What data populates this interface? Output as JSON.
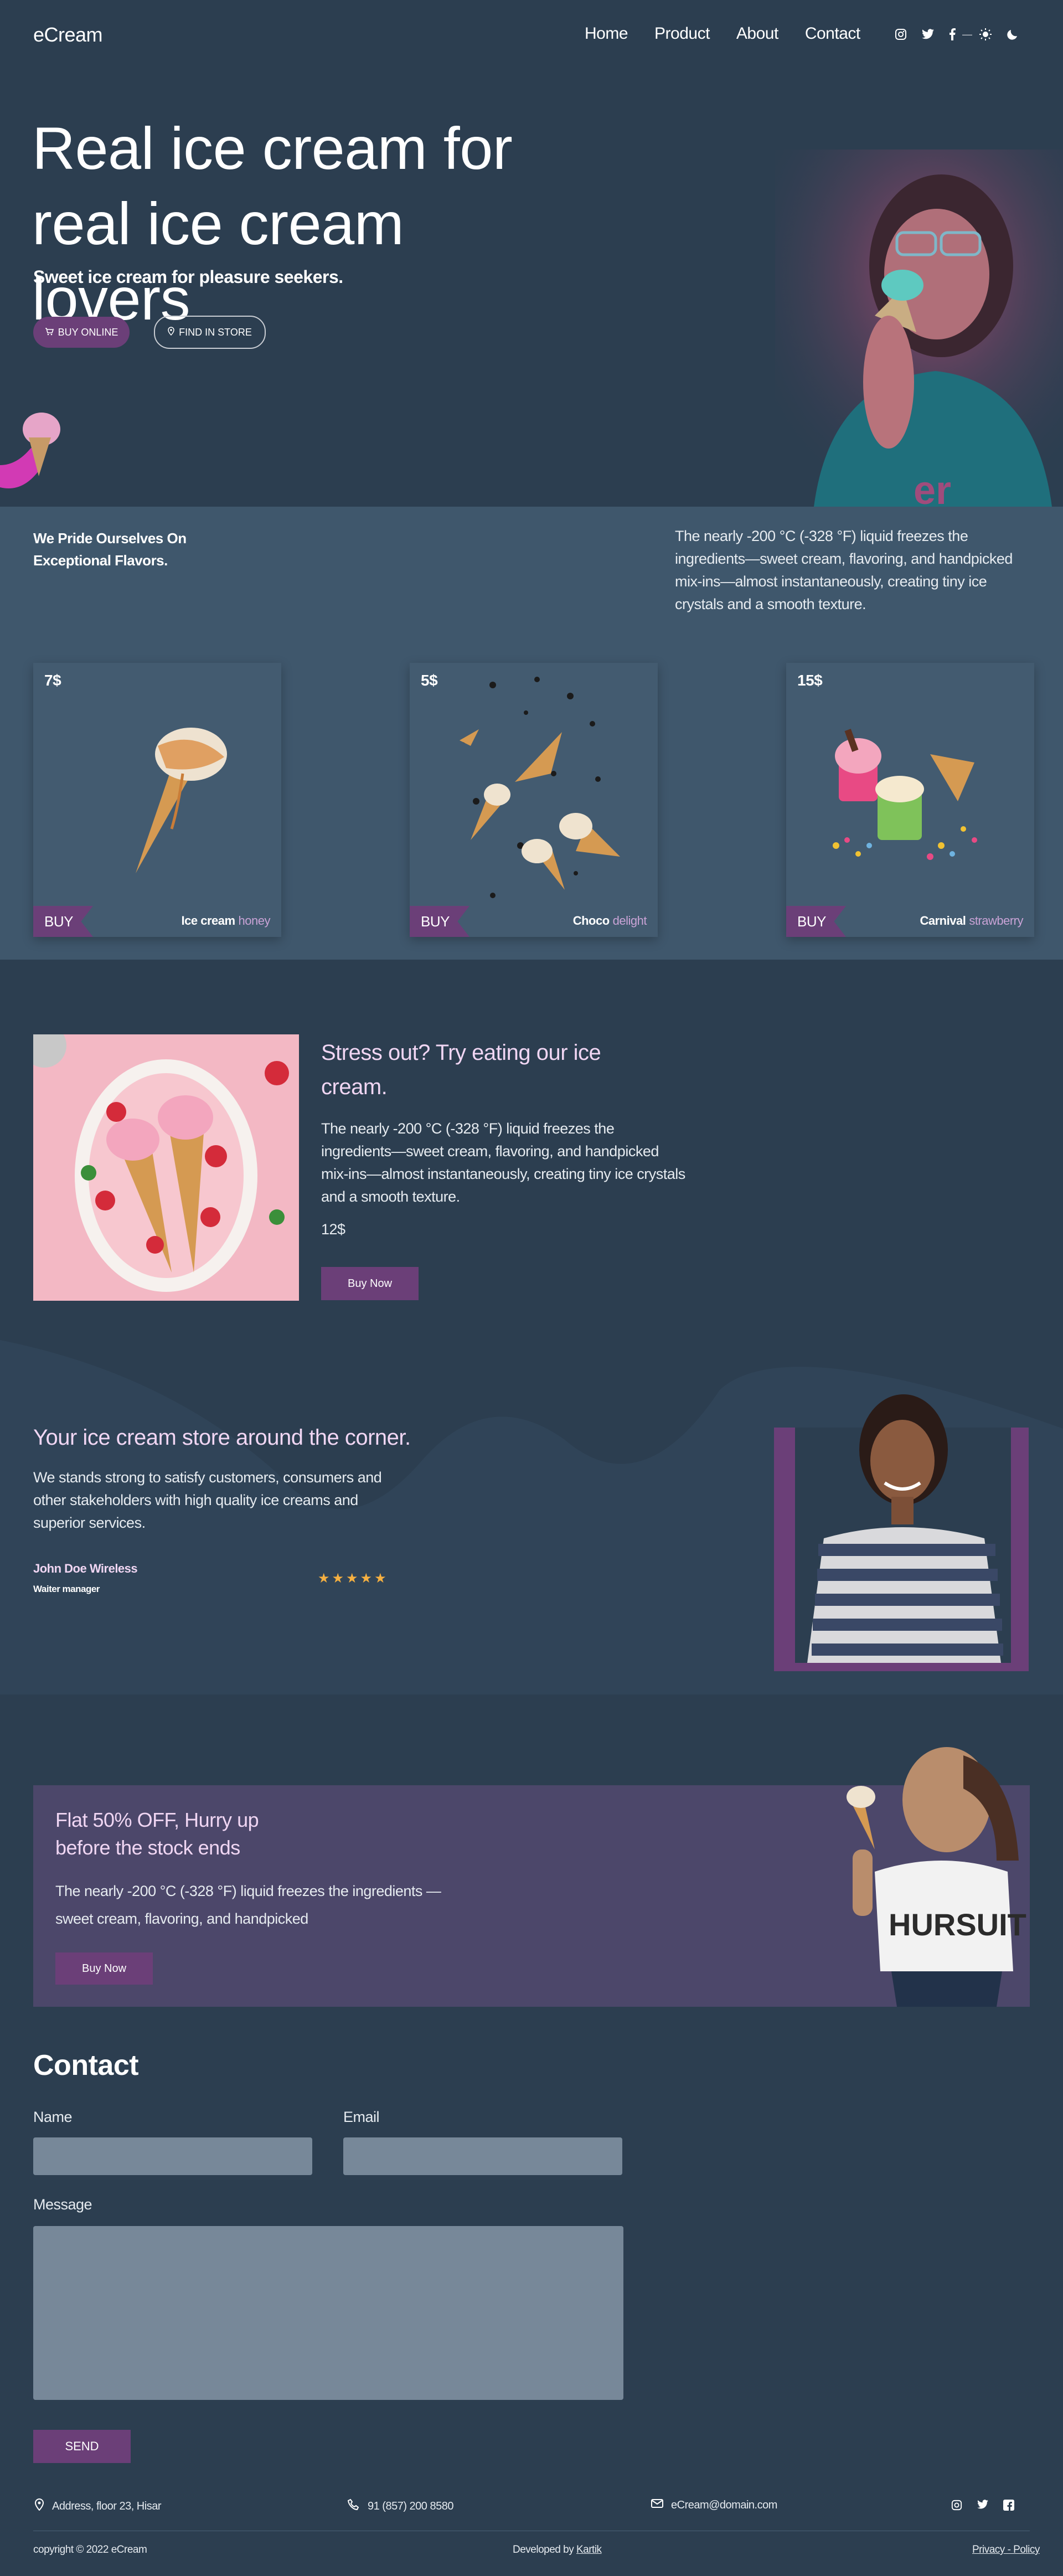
{
  "nav": {
    "logo": "eCream",
    "menu": [
      "Home",
      "Product",
      "About",
      "Contact"
    ],
    "social_icons": [
      "instagram-icon",
      "twitter-icon",
      "facebook-icon"
    ],
    "theme_icons": [
      "sun-icon",
      "moon-icon"
    ],
    "theme_separator": "—"
  },
  "hero": {
    "title": "Real ice cream for real ice cream lovers",
    "subtitle": "Sweet ice cream for pleasure seekers.",
    "buy_online": "BUY ONLINE",
    "find_in_store": "FIND IN STORE"
  },
  "pride": {
    "heading_line1": "We Pride Ourselves On",
    "heading_line2": "Exceptional Flavors.",
    "text": "The nearly -200 °C (-328 °F) liquid freezes the ingredients—sweet cream, flavoring, and handpicked mix-ins—almost instantaneously, creating tiny ice crystals and a smooth texture."
  },
  "products": [
    {
      "price": "7$",
      "buy": "BUY",
      "name": "Ice cream",
      "flavor": "honey"
    },
    {
      "price": "5$",
      "buy": "BUY",
      "name": "Choco",
      "flavor": "delight"
    },
    {
      "price": "15$",
      "buy": "BUY",
      "name": "Carnival",
      "flavor": "strawberry"
    }
  ],
  "stress": {
    "title": "Stress out? Try eating our ice cream.",
    "text": "The nearly -200 °C (-328 °F) liquid freezes the ingredients—sweet cream, flavoring, and handpicked mix-ins—almost instantaneously, creating tiny ice crystals and a smooth texture.",
    "price": "12$",
    "button": "Buy Now"
  },
  "store": {
    "title": "Your ice cream store around the corner.",
    "text": "We stands strong to satisfy customers, consumers and other stakeholders with high quality ice creams and superior services.",
    "person": "John Doe Wireless",
    "role": "Waiter manager",
    "rating": 5
  },
  "promo": {
    "title": "Flat 50% OFF, Hurry up before the stock ends",
    "text": "The nearly -200 °C (-328 °F) liquid freezes the ingredients —sweet cream, flavoring, and handpicked",
    "button": "Buy Now"
  },
  "contact": {
    "title": "Contact",
    "name_label": "Name",
    "email_label": "Email",
    "message_label": "Message",
    "name_value": "",
    "email_value": "",
    "message_value": "",
    "send": "SEND"
  },
  "footer": {
    "address": "Address, floor 23, Hisar",
    "phone": "91 (857) 200 8580",
    "email": "eCream@domain.com",
    "copyright": "copyright © 2022 eCream",
    "developed_prefix": "Developed by",
    "developer": "Kartik",
    "privacy": "Privacy - Policy"
  },
  "colors": {
    "background": "#2c3e50",
    "band": "#3f576c",
    "accent": "#6b3f78",
    "promo": "#4c476a",
    "field": "#778899",
    "star": "#f5b041"
  }
}
